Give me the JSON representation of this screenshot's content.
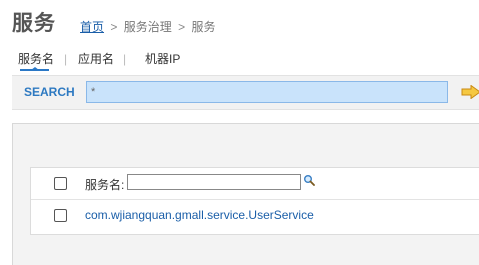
{
  "header": {
    "title": "服务",
    "breadcrumb": {
      "home": "首页",
      "separator": ">",
      "level2": "服务治理",
      "level3": "服务"
    }
  },
  "tabs": [
    {
      "label": "服务名",
      "active": true
    },
    {
      "label": "应用名",
      "active": false
    },
    {
      "label": "机器IP",
      "active": false
    }
  ],
  "tab_divider": "|",
  "search": {
    "label": "SEARCH",
    "value": "*",
    "go_icon": "arrow-right-icon"
  },
  "table": {
    "filter_label": "服务名:",
    "filter_value": "",
    "filter_icon": "magnifier-icon",
    "rows": [
      {
        "service": "com.wjiangquan.gmall.service.UserService"
      }
    ]
  },
  "colors": {
    "accent": "#2a78c6",
    "link": "#1a5ea8",
    "search_bg": "#c9e3fb",
    "go_arrow": "#f0b429"
  }
}
